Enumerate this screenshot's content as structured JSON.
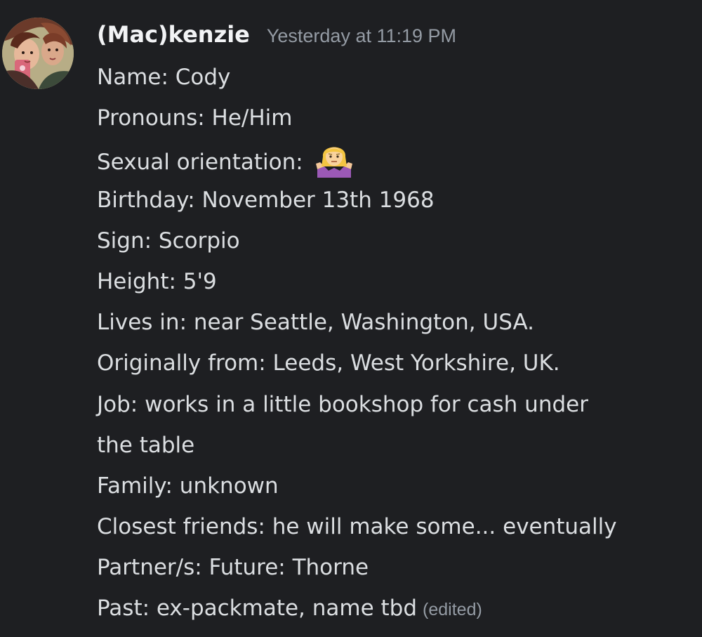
{
  "message": {
    "author": "(Mac)kenzie",
    "timestamp": "Yesterday at 11:19 PM",
    "avatar_icon": "avatar-illustration-icon",
    "lines": {
      "name": "Name: Cody",
      "pronouns": "Pronouns: He/Him",
      "orientation_label": "Sexual orientation:",
      "orientation_emoji": "shrug-emoji-icon",
      "birthday": "Birthday: November 13th 1968",
      "sign": "Sign: Scorpio",
      "height": "Height: 5'9",
      "lives_in": "Lives in: near Seattle, Washington, USA.",
      "originally_from": "Originally from: Leeds, West Yorkshire, UK.",
      "job_line1": "Job: works in a little bookshop for cash under",
      "job_line2": "the table",
      "family": "Family: unknown",
      "closest_friends": "Closest friends: he will make some... eventually",
      "partners": "Partner/s: Future: Thorne",
      "past": "Past: ex-packmate, name tbd"
    },
    "edited_label": "(edited)"
  },
  "colors": {
    "background": "#1e1f22",
    "text": "#dbdee1",
    "username": "#f2f3f5",
    "muted": "#949ba4"
  }
}
